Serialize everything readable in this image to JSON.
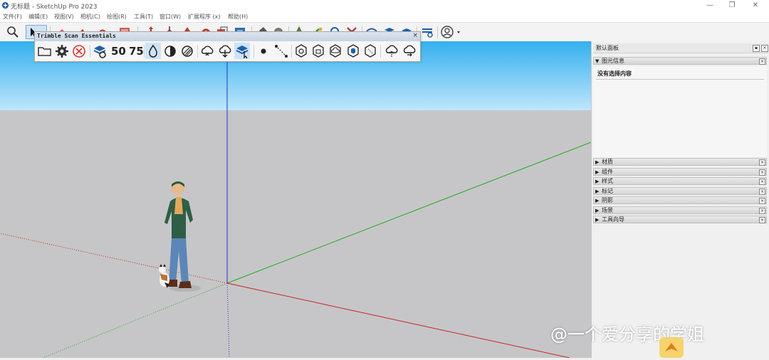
{
  "window": {
    "title": "无标题 - SketchUp Pro 2023",
    "minimize": "—",
    "restore": "❐",
    "close": "✕"
  },
  "menu": [
    "文件(F)",
    "编辑(E)",
    "视图(V)",
    "相机(C)",
    "绘图(R)",
    "工具(T)",
    "窗口(W)",
    "扩展程序 (x)",
    "帮助(H)"
  ],
  "floating_toolbar": {
    "title": "Trimble Scan Essentials",
    "close": "×",
    "label_50": "50",
    "label_75": "75"
  },
  "panel": {
    "title": "默认面板",
    "entity_info": {
      "label": "图元信息",
      "state": "expanded",
      "empty_text": "没有选择内容"
    },
    "sections": [
      "材质",
      "组件",
      "样式",
      "标记",
      "阴影",
      "场景",
      "工具向导"
    ]
  },
  "watermark": "@一个爱分享的学姐",
  "colors": {
    "sky_top": "#33b0ef",
    "sky_bottom": "#bfe6fb",
    "ground": "#c6c6c8",
    "axis_red": "#cc2222",
    "axis_green": "#22aa22",
    "axis_blue": "#2233cc",
    "accent": "#1f5fa8"
  },
  "icons": {
    "toolbar": [
      "zoom-icon",
      "select-icon",
      "eraser-icon",
      "pencil-icon",
      "arc-icon",
      "rectangle-icon",
      "move-icon",
      "push-pull-icon",
      "rotate-icon",
      "follow-me-icon",
      "scale-icon",
      "offset-icon",
      "paint-bucket-icon",
      "tape-measure-icon",
      "text-icon",
      "axes-icon",
      "orbit-icon",
      "pan-icon",
      "zoom-extents-icon",
      "previous-view-icon",
      "scan-wifi-icon",
      "scan-layers-icon",
      "scan-stack-icon",
      "scan-settings-icon",
      "account-icon"
    ],
    "scan": [
      "open-folder-icon",
      "settings-gear-icon",
      "cancel-icon",
      "point-cloud-icon",
      "density-50-icon",
      "density-75-icon",
      "drop-icon",
      "contrast-icon",
      "hatch-icon",
      "cloud-x-icon",
      "cloud-download-icon",
      "layers-cursor-icon",
      "point-icon",
      "line-points-icon",
      "crop-icon",
      "polygon-icon",
      "cloud-shape-icon",
      "hex-fill-icon",
      "hex-outline-icon",
      "cloud-upload-icon",
      "cloud-sync-icon"
    ]
  }
}
